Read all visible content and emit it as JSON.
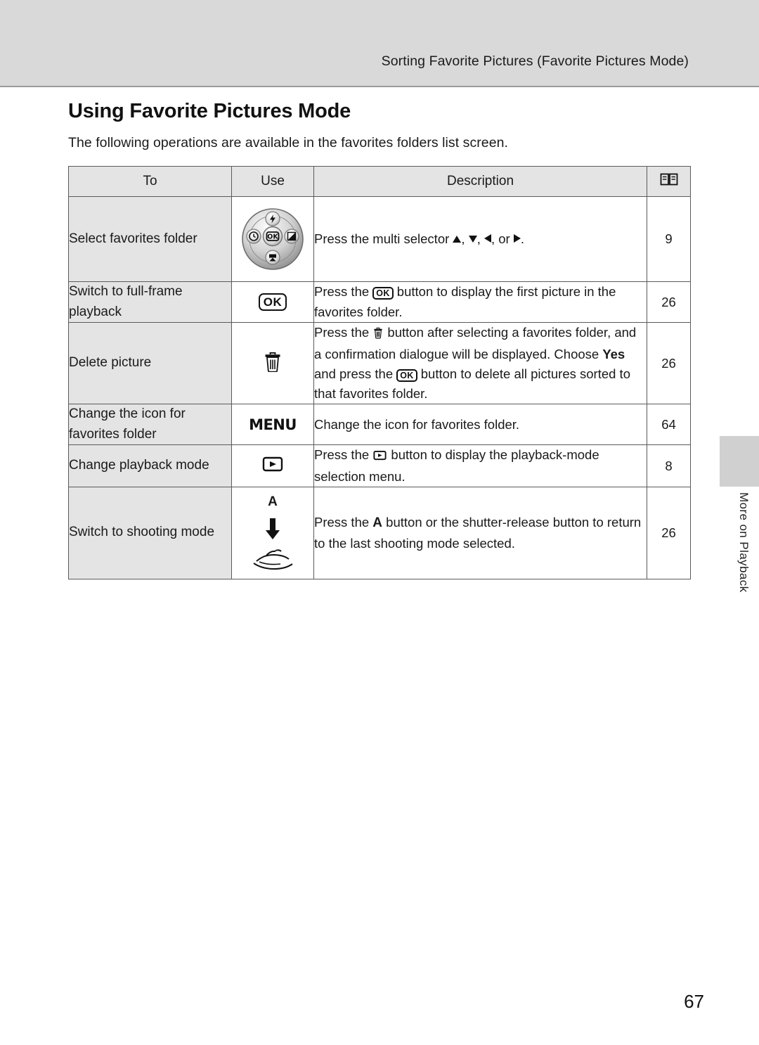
{
  "header": {
    "running_title": "Sorting Favorite Pictures (Favorite Pictures Mode)",
    "side_tab_label": "More on Playback"
  },
  "page": {
    "title": "Using Favorite Pictures Mode",
    "lead": "The following operations are available in the favorites folders list screen.",
    "page_number": "67"
  },
  "table": {
    "headers": {
      "to": "To",
      "use": "Use",
      "description": "Description",
      "reference": "book-icon"
    },
    "rows": [
      {
        "to": "Select favorites folder",
        "use_icon": "multi-selector-dial",
        "desc_prefix": "Press the multi selector ",
        "desc_mid1": ", ",
        "desc_mid2": ", ",
        "desc_mid3": ", or ",
        "desc_suffix": ".",
        "ref": "9"
      },
      {
        "to": "Switch to full-frame playback",
        "use_icon": "ok-button",
        "use_label": "OK",
        "desc_part1": "Press the ",
        "desc_ok": "OK",
        "desc_part2": " button to display the first picture in the favorites folder.",
        "ref": "26"
      },
      {
        "to": "Delete picture",
        "use_icon": "trash-button",
        "desc_part1": "Press the ",
        "desc_part2": " button after selecting a favorites folder, and a confirmation dialogue will be displayed. Choose ",
        "desc_yes": "Yes",
        "desc_part3": " and press the ",
        "desc_ok": "OK",
        "desc_part4": " button to delete all pictures sorted to that favorites folder.",
        "ref": "26"
      },
      {
        "to": "Change the icon for favorites folder",
        "use_icon": "menu-button",
        "use_label": "MENU",
        "desc": "Change the icon for favorites folder.",
        "ref": "64"
      },
      {
        "to": "Change playback mode",
        "use_icon": "playback-button",
        "desc_part1": "Press the ",
        "desc_part2": " button to display the playback-mode selection menu.",
        "ref": "8"
      },
      {
        "to": "Switch to shooting mode",
        "use_icon_top": "mode-a-button",
        "use_label_top": "A",
        "use_icon_arrow": "down-arrow",
        "use_icon_bottom": "shutter-release-button",
        "desc_part1": "Press the ",
        "desc_a": "A",
        "desc_part2": " button or the shutter-release button to return to the last shooting mode selected.",
        "ref": "26"
      }
    ]
  }
}
